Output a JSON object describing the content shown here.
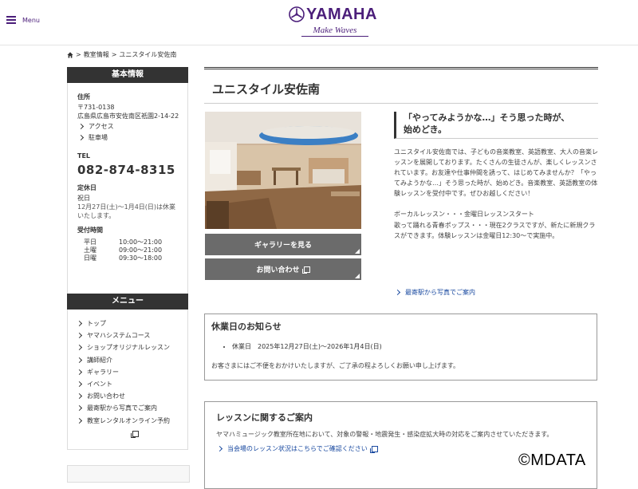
{
  "header": {
    "menu_label": "Menu",
    "brand": "YAMAHA",
    "tagline": "Make Waves",
    "brand_color": "#4b1e7a"
  },
  "breadcrumb": {
    "home_icon": "home-icon",
    "items": [
      "教室情報",
      "ユニスタイル安佐南"
    ],
    "separator": ">"
  },
  "sidebar": {
    "info": {
      "heading": "基本情報",
      "address_label": "住所",
      "postal": "〒731-0138",
      "address": "広島県広島市安佐南区祇園2-14-22",
      "links": [
        "アクセス",
        "駐車場"
      ],
      "tel_label": "TEL",
      "tel": "082-874-8315",
      "holiday_label": "定休日",
      "holiday": "祝日",
      "holiday_note": "12月27日(土)～1月4日(日)は休業いたします。",
      "hours_label": "受付時間",
      "hours": [
        {
          "day": "平日",
          "time": "10:00～21:00"
        },
        {
          "day": "土曜",
          "time": "09:00～21:00"
        },
        {
          "day": "日曜",
          "time": "09:30～18:00"
        }
      ]
    },
    "menu": {
      "heading": "メニュー",
      "items": [
        "トップ",
        "ヤマハシステムコース",
        "ショップオリジナルレッスン",
        "講師紹介",
        "ギャラリー",
        "イベント",
        "お問い合わせ",
        "最寄駅から写真でご案内",
        "教室レンタルオンライン予約"
      ]
    }
  },
  "main": {
    "title": "ユニスタイル安佐南",
    "gallery_button": "ギャラリーを見る",
    "contact_button": "お問い合わせ",
    "catch_line1": "「やってみようかな…」そう思った時が、",
    "catch_line2": "始めどき。",
    "description": [
      "ユニスタイル安佐南では、子どもの音楽教室、英語教室、大人の音楽レッスンを展開しております。たくさんの生徒さんが、楽しくレッスンされています。お友達や仕事仲間を誘って、はじめてみませんか？「やってみようかな…」そう思った時が、始めどき。音楽教室、英語教室の体験レッスンを受付中です。ぜひお越しください！",
      "ボーカルレッスン・・・金曜日レッスンスタート",
      "歌って踊れる青春ポップス・・・現在2クラスですが、新たに新規クラスができます。体験レッスンは金曜日12:30～で実施中。"
    ],
    "access_link": "最寄駅から写真でご案内"
  },
  "notice": {
    "title": "休業日のお知らせ",
    "item": "休業日　2025年12月27日(土)～2026年1月4日(日)",
    "message": "お客さまにはご不便をおかけいたしますが、ご了承の程よろしくお願い申し上げます。"
  },
  "lesson": {
    "title": "レッスンに関するご案内",
    "text": "ヤマハミュージック教室所在地において、対象の警報・地震発生・感染症拡大時の対応をご案内させていただきます。",
    "link": "当会場のレッスン状況はこちらでご確認ください"
  },
  "watermark": "©MDATA"
}
